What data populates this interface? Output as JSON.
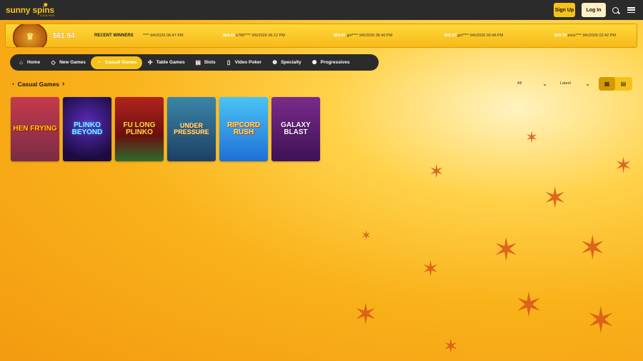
{
  "brand": {
    "name": "sunny spins",
    "tagline": "CASINO"
  },
  "header": {
    "signup_label": "Sign Up",
    "login_label": "Log In",
    "search_icon": "search-icon",
    "menu_icon": "hamburger-menu-icon"
  },
  "jackpot": {
    "amount": "$61.94"
  },
  "winners": {
    "label": "RECENT WINNERS",
    "items": [
      {
        "amount": "",
        "user": "****",
        "time": "9/6/2026 06:47 PM"
      },
      {
        "amount": "$68.41",
        "user": "k780****",
        "time": "9/6/2026 06:12 PM"
      },
      {
        "amount": "$59.87",
        "user": "girl****",
        "time": "9/6/2026 05:40 PM"
      },
      {
        "amount": "$45.97",
        "user": "girl****",
        "time": "9/6/2026 03:48 PM"
      },
      {
        "amount": "$29.79",
        "user": "elvis****",
        "time": "9/6/2026 02:42 PM"
      }
    ]
  },
  "nav": {
    "items": [
      {
        "label": "Home",
        "icon": "home-icon"
      },
      {
        "label": "New Games",
        "icon": "diamond-icon"
      },
      {
        "label": "Casual Games",
        "icon": "casual-icon",
        "active": true
      },
      {
        "label": "Table Games",
        "icon": "table-icon"
      },
      {
        "label": "Slots",
        "icon": "slots-icon"
      },
      {
        "label": "Video Poker",
        "icon": "poker-icon"
      },
      {
        "label": "Specialty",
        "icon": "specialty-icon"
      },
      {
        "label": "Progressives",
        "icon": "progressives-icon"
      }
    ]
  },
  "section": {
    "title": "Casual Games"
  },
  "filters": {
    "category": "All",
    "sort": "Latest"
  },
  "games": [
    {
      "title": "HEN FRYING"
    },
    {
      "title": "PLINKO BEYOND"
    },
    {
      "title": "FU LONG PLINKO"
    },
    {
      "title": "UNDER PRESSURE"
    },
    {
      "title": "RIPCORD RUSH"
    },
    {
      "title": "GALAXY BLAST"
    }
  ],
  "colors": {
    "accent": "#f5c21b",
    "bar": "#2b2b2b"
  }
}
